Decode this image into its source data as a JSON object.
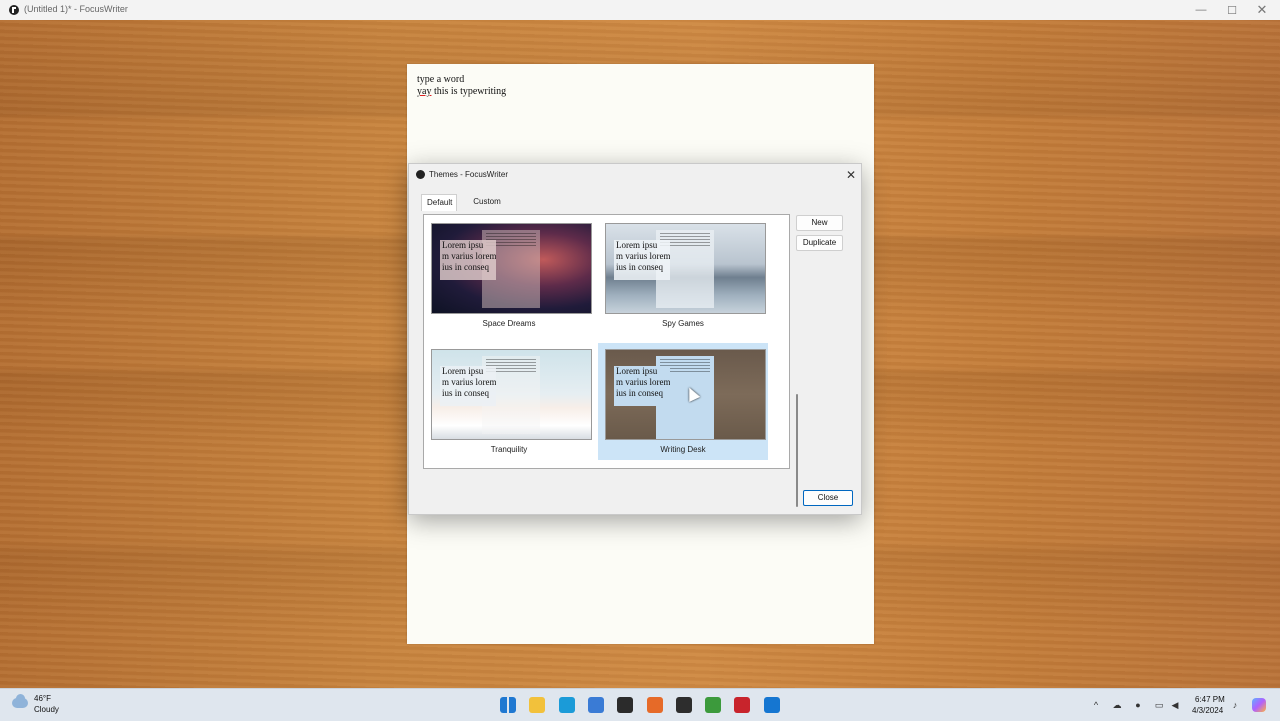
{
  "window": {
    "title": "(Untitled 1)* - FocusWriter"
  },
  "document": {
    "lines": [
      {
        "text": "type a word"
      },
      {
        "misspelled": "yay",
        "rest": " this is typewriting"
      }
    ]
  },
  "dialog": {
    "title": "Themes - FocusWriter",
    "tabs": [
      {
        "label": "Default"
      },
      {
        "label": "Custom"
      }
    ],
    "themes": [
      {
        "name": "Space Dreams",
        "preview_text": "Lorem ipsu\nm varius lorem\nius in conseq"
      },
      {
        "name": "Spy Games",
        "preview_text": "Lorem ipsu\nm varius lorem\nius in conseq"
      },
      {
        "name": "Tranquility",
        "preview_text": "Lorem ipsu\nm varius lorem\nius in conseq"
      },
      {
        "name": "Writing Desk",
        "preview_text": "Lorem ipsu\nm varius lorem\nius in conseq"
      }
    ],
    "selected_theme": "Writing Desk",
    "buttons": {
      "new": "New",
      "duplicate": "Duplicate",
      "close": "Close"
    }
  },
  "taskbar": {
    "weather": {
      "temp": "46°F",
      "condition": "Cloudy"
    },
    "clock": {
      "time": "6:47 PM",
      "date": "4/3/2024"
    },
    "pinned": [
      {
        "name": "start-icon",
        "color": "#1f78d1"
      },
      {
        "name": "file-explorer-icon",
        "color": "#f2c13b"
      },
      {
        "name": "edge-icon",
        "color": "#1b9bd8"
      },
      {
        "name": "store-icon",
        "color": "#3a7bd5"
      },
      {
        "name": "focuswriter-icon",
        "color": "#2b2b2b"
      },
      {
        "name": "firefox-icon",
        "color": "#e66a28"
      },
      {
        "name": "obs-icon",
        "color": "#2d2d2d"
      },
      {
        "name": "minecraft-icon",
        "color": "#3c9a3c"
      },
      {
        "name": "app-red-icon",
        "color": "#c8242c"
      },
      {
        "name": "app-blue-icon",
        "color": "#1576d1"
      }
    ]
  }
}
